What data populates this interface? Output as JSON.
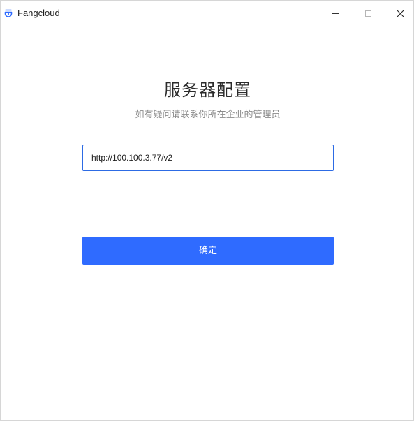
{
  "window": {
    "title": "Fangcloud",
    "logo_icon": "fangcloud-logo-icon",
    "controls": [
      "minimize-icon",
      "maximize-icon",
      "close-icon"
    ]
  },
  "main": {
    "heading": "服务器配置",
    "subheading": "如有疑问请联系你所在企业的管理员",
    "server_input": {
      "value": "http://100.100.3.77/v2",
      "placeholder": ""
    },
    "confirm_label": "确定"
  },
  "colors": {
    "accent": "#2f6bff",
    "input_border": "#2d6be4",
    "logo": "#2f6bff",
    "heading_text": "#2b2b2b",
    "subheading_text": "#8c8c8c"
  }
}
